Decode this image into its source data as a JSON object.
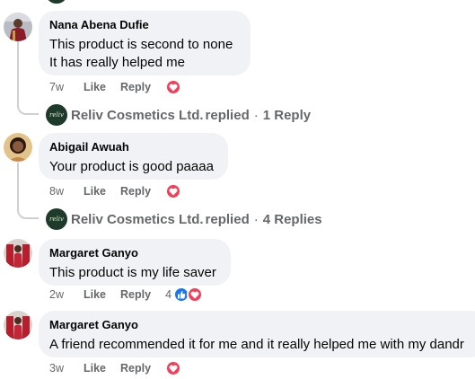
{
  "comments": [
    {
      "author": "Nana Abena Dufie",
      "lines": [
        "This product is second to none",
        "It has really helped me"
      ],
      "time": "7w",
      "like_label": "Like",
      "reply_label": "Reply",
      "reactions": [
        "love"
      ],
      "reaction_count": "",
      "replies": {
        "page_name": "Reliv Cosmetics Ltd.",
        "logo_text": "reliv",
        "action": "replied",
        "separator": "·",
        "count_text": "1 Reply"
      }
    },
    {
      "author": "Abigail Awuah",
      "lines": [
        "Your product is good paaaa"
      ],
      "time": "8w",
      "like_label": "Like",
      "reply_label": "Reply",
      "reactions": [
        "love"
      ],
      "reaction_count": "",
      "replies": {
        "page_name": "Reliv Cosmetics Ltd.",
        "logo_text": "reliv",
        "action": "replied",
        "separator": "·",
        "count_text": "4 Replies"
      }
    },
    {
      "author": "Margaret Ganyo",
      "lines": [
        "This product is my life saver"
      ],
      "time": "2w",
      "like_label": "Like",
      "reply_label": "Reply",
      "reactions": [
        "like",
        "love"
      ],
      "reaction_count": "4"
    },
    {
      "author": "Margaret Ganyo",
      "lines": [
        "A friend recommended it for me and it really helped me with my dandr"
      ],
      "time": "3w",
      "like_label": "Like",
      "reply_label": "Reply",
      "reactions": [
        "love"
      ],
      "reaction_count": ""
    }
  ],
  "colors": {
    "bubble": "#f0f2f5",
    "meta": "#65676b",
    "love": "#f33e58",
    "like": "#1877f2",
    "logo_bg": "#1d3a2b"
  }
}
